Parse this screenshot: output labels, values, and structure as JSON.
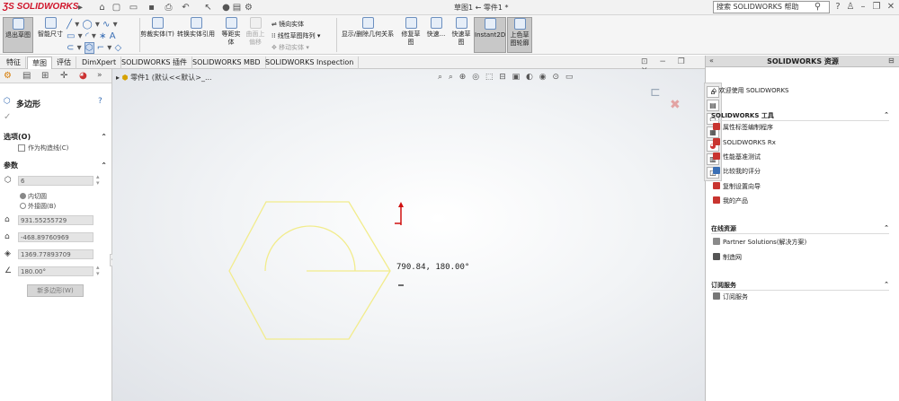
{
  "app": {
    "logo": "SOLIDWORKS",
    "doc_title": "草图1 ← 零件1 *"
  },
  "search": {
    "text": "搜索 SOLIDWORKS 帮助"
  },
  "ribbon": {
    "exit_sketch": "退出草图",
    "smart_dimension": "智能尺寸",
    "trim": "剪裁实体(T)",
    "convert": "转换实体引用",
    "offset_1": "等距实",
    "offset_2": "体",
    "surface_offset_1": "曲面上",
    "surface_offset_2": "偏移",
    "mirror": "镜向实体",
    "linear_pattern": "线性草图阵列",
    "move": "移动实体",
    "display_delete": "显示/删除几何关系",
    "repair_1": "修复草",
    "repair_2": "图",
    "quick_snap": "快速...",
    "rapid_1": "快速草",
    "rapid_2": "图",
    "instant2d": "Instant2D",
    "shaded_1": "上色草",
    "shaded_2": "图轮廓"
  },
  "tabs": [
    "特征",
    "草图",
    "评估",
    "DimXpert",
    "SOLIDWORKS 插件",
    "SOLIDWORKS MBD",
    "SOLIDWORKS Inspection"
  ],
  "tree": {
    "breadcrumb": "零件1 (默认<<默认>_..."
  },
  "pm": {
    "title": "多边形",
    "options_header": "选项(O)",
    "construction": "作为构造线(C)",
    "params_header": "参数",
    "sides": "6",
    "inscribed": "内切圆",
    "circumscribed": "外接圆(B)",
    "center_x": "931.55255729",
    "center_y": "-468.89760969",
    "diameter": "1369.77893709",
    "angle": "180.00°",
    "new_polygon": "新多边形(W)"
  },
  "canvas": {
    "dim_readout": "790.84, 180.00°",
    "sketch_color": "#f2ec8c"
  },
  "resources": {
    "title": "SOLIDWORKS 资源",
    "welcome": "欢迎使用 SOLIDWORKS",
    "tools_header": "SOLIDWORKS 工具",
    "tools": [
      "属性标签编制程序",
      "SOLIDWORKS Rx",
      "性能基准测试",
      "比较我的评分",
      "复制设置向导",
      "我的产品"
    ],
    "online_header": "在线资源",
    "online": [
      "Partner Solutions(解决方案)",
      "制造网"
    ],
    "subscription_header": "订阅服务",
    "subscription": [
      "订阅服务"
    ]
  }
}
